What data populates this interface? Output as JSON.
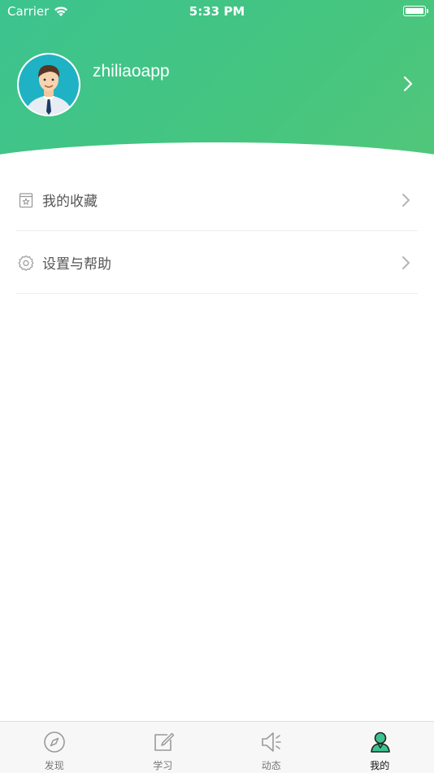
{
  "status_bar": {
    "carrier": "Carrier",
    "time": "5:33 PM"
  },
  "profile": {
    "username": "zhiliaoapp"
  },
  "menu": {
    "items": [
      {
        "label": "我的收藏",
        "icon": "favorites-icon"
      },
      {
        "label": "设置与帮助",
        "icon": "settings-icon"
      }
    ]
  },
  "tabbar": {
    "tabs": [
      {
        "label": "发现",
        "icon": "compass-icon",
        "active": false
      },
      {
        "label": "学习",
        "icon": "edit-icon",
        "active": false
      },
      {
        "label": "动态",
        "icon": "speaker-icon",
        "active": false
      },
      {
        "label": "我的",
        "icon": "user-icon",
        "active": true
      }
    ]
  },
  "colors": {
    "header_start": "#3cc38f",
    "header_end": "#52c67a",
    "active_tab_accent": "#3cc38f"
  }
}
